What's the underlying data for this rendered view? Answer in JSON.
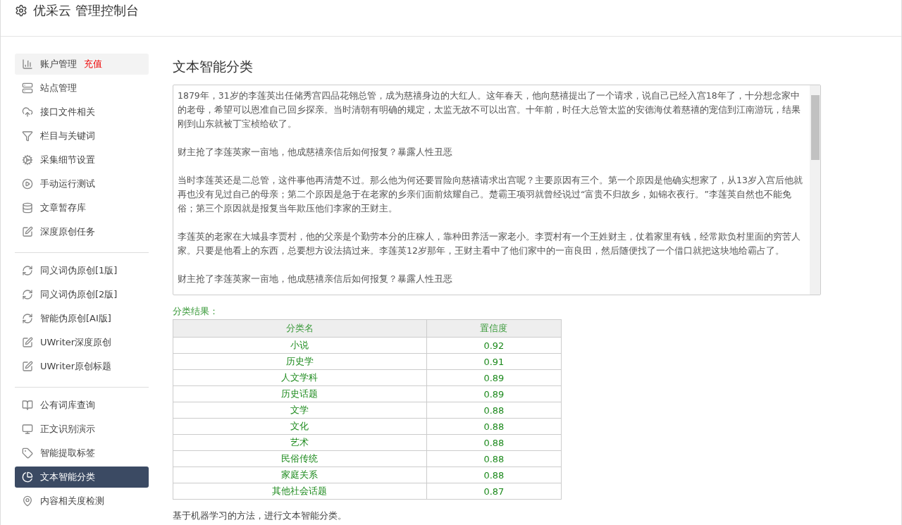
{
  "header": {
    "title": "优采云 管理控制台"
  },
  "sidebar": {
    "sections": [
      {
        "items": [
          {
            "label": "账户管理",
            "badge": "充值",
            "selected": false,
            "highlighted": true
          },
          {
            "label": "站点管理",
            "selected": false
          },
          {
            "label": "接口文件相关",
            "selected": false
          },
          {
            "label": "栏目与关键词",
            "selected": false
          },
          {
            "label": "采集细节设置",
            "selected": false
          },
          {
            "label": "手动运行测试",
            "selected": false
          },
          {
            "label": "文章暂存库",
            "selected": false
          },
          {
            "label": "深度原创任务",
            "selected": false
          }
        ]
      },
      {
        "items": [
          {
            "label": "同义词伪原创[1版]",
            "selected": false
          },
          {
            "label": "同义词伪原创[2版]",
            "selected": false
          },
          {
            "label": "智能伪原创[AI版]",
            "selected": false
          },
          {
            "label": "UWriter深度原创",
            "selected": false
          },
          {
            "label": "UWriter原创标题",
            "selected": false
          }
        ]
      },
      {
        "items": [
          {
            "label": "公有词库查询",
            "selected": false
          },
          {
            "label": "正文识别演示",
            "selected": false
          },
          {
            "label": "智能提取标签",
            "selected": false
          },
          {
            "label": "文本智能分类",
            "selected": true
          },
          {
            "label": "内容相关度检测",
            "selected": false
          }
        ]
      }
    ]
  },
  "main": {
    "title": "文本智能分类",
    "article_paragraphs": [
      "1879年，31岁的李莲英出任储秀宫四品花翎总管，成为慈禧身边的大红人。这年春天，他向慈禧提出了一个请求，说自己已经入宫18年了，十分想念家中的老母，希望可以恩准自己回乡探亲。当时清朝有明确的规定，太监无故不可以出宫。十年前，时任大总管太监的安德海仗着慈禧的宠信到江南游玩，结果刚到山东就被丁宝桢给砍了。",
      "财主抢了李莲英家一亩地，他成慈禧亲信后如何报复？暴露人性丑恶",
      "当时李莲英还是二总管，这件事他再清楚不过。那么他为何还要冒险向慈禧请求出宫呢？主要原因有三个。第一个原因是他确实想家了，从13岁入宫后他就再也没有见过自己的母亲；第二个原因是急于在老家的乡亲们面前炫耀自己。楚霸王项羽就曾经说过“富贵不归故乡，如锦衣夜行。”李莲英自然也不能免俗；第三个原因就是报复当年欺压他们李家的王财主。",
      "李莲英的老家在大城县李贾村，他的父亲是个勤劳本分的庄稼人，靠种田养活一家老小。李贾村有一个王姓财主，仗着家里有钱，经常欺负村里面的穷苦人家。只要是他看上的东西，总要想方设法搞过来。李莲英12岁那年，王财主看中了他们家中的一亩良田，然后随便找了一个借口就把这块地给霸占了。",
      "财主抢了李莲英家一亩地，他成慈禧亲信后如何报复？暴露人性丑恶"
    ],
    "result_label": "分类结果：",
    "table": {
      "columns": [
        "分类名",
        "置信度"
      ],
      "rows": [
        [
          "小说",
          "0.92"
        ],
        [
          "历史学",
          "0.91"
        ],
        [
          "人文学科",
          "0.89"
        ],
        [
          "历史话题",
          "0.89"
        ],
        [
          "文学",
          "0.88"
        ],
        [
          "文化",
          "0.88"
        ],
        [
          "艺术",
          "0.88"
        ],
        [
          "民俗传统",
          "0.88"
        ],
        [
          "家庭关系",
          "0.88"
        ],
        [
          "其他社会话题",
          "0.87"
        ]
      ]
    },
    "footnote": "基于机器学习的方法，进行文本智能分类。"
  }
}
